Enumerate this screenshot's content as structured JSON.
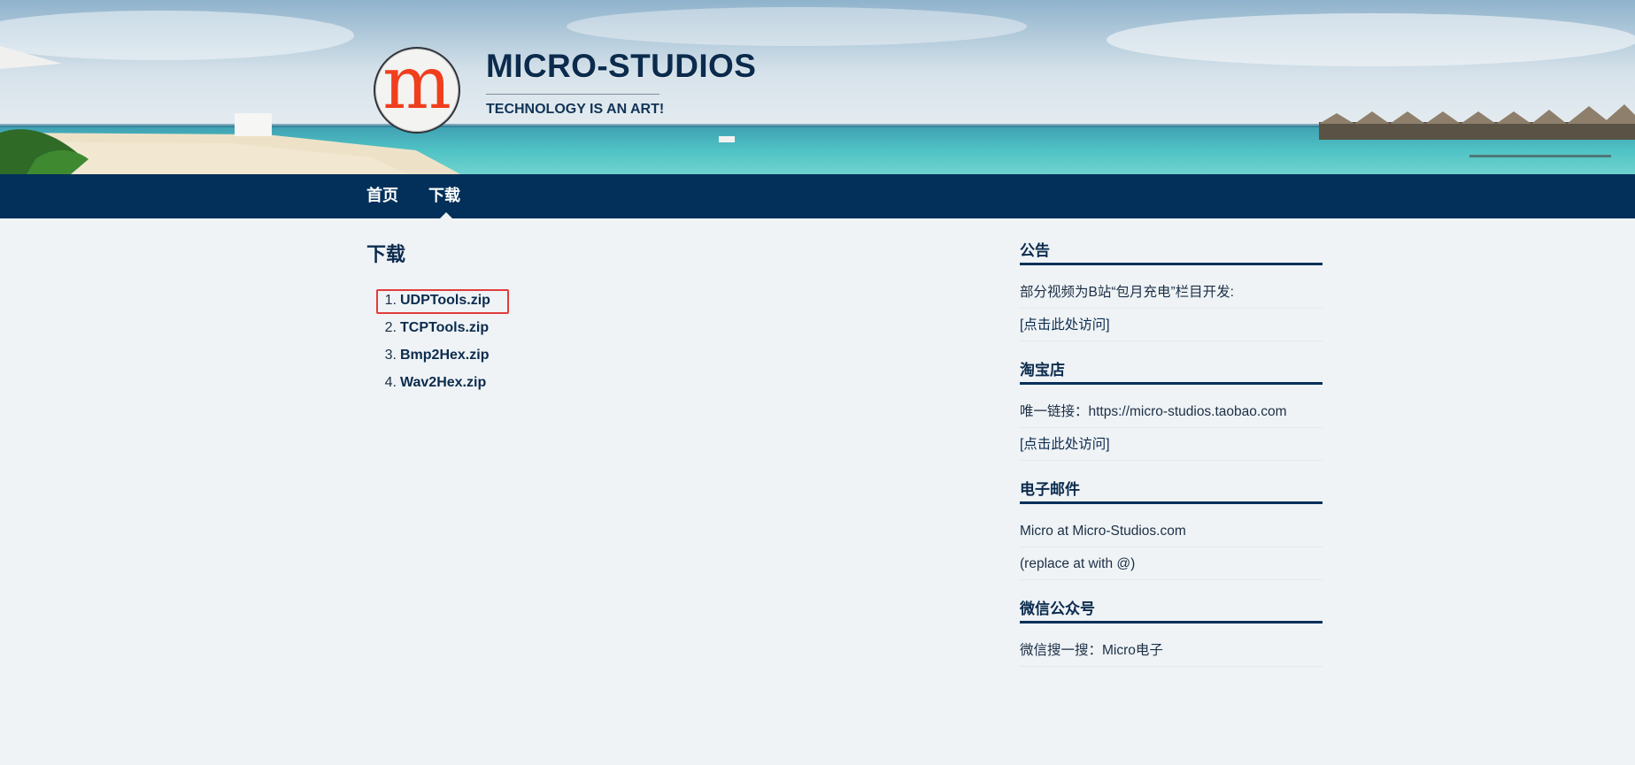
{
  "header": {
    "site_title": "MICRO-STUDIOS",
    "tagline": "TECHNOLOGY IS AN ART!",
    "logo_letter": "m"
  },
  "nav": {
    "items": [
      {
        "label": "首页"
      },
      {
        "label": "下载",
        "active": true
      }
    ]
  },
  "main": {
    "heading": "下载",
    "downloads": [
      {
        "num": "1.",
        "label": "UDPTools.zip",
        "highlighted": true
      },
      {
        "num": "2.",
        "label": "TCPTools.zip"
      },
      {
        "num": "3.",
        "label": "Bmp2Hex.zip"
      },
      {
        "num": "4.",
        "label": "Wav2Hex.zip"
      }
    ]
  },
  "sidebar": {
    "announcement": {
      "title": "公告",
      "text": "部分视频为B站“包月充电”栏目开发:",
      "link": "[点击此处访问]"
    },
    "taobao": {
      "title": "淘宝店",
      "text": "唯一链接：https://micro-studios.taobao.com",
      "link": "[点击此处访问]"
    },
    "email": {
      "title": "电子邮件",
      "text": "Micro at Micro-Studios.com",
      "note": "(replace at with @)"
    },
    "wechat": {
      "title": "微信公众号",
      "text": "微信搜一搜：Micro电子"
    }
  },
  "colors": {
    "nav_bg": "#02305a",
    "page_bg": "#eff3f6",
    "highlight": "#e23c3c",
    "logo_red": "#ef3f1d"
  }
}
